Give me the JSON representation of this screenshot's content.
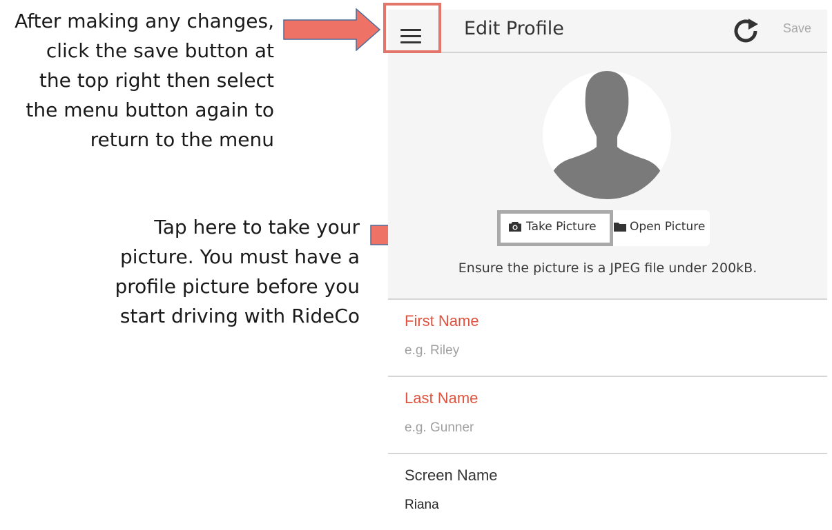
{
  "annotations": {
    "menu_note": [
      "After making any changes,",
      "click the save button at",
      "the top right then select",
      "the menu button again to",
      "return to the menu"
    ],
    "picture_note": [
      "Tap here to take your",
      "picture. You must have a",
      "profile picture before you",
      "start driving with RideCo"
    ],
    "arrow_color": "#ef7267",
    "highlight_menu_color": "#e4756a",
    "highlight_take_color": "#a9a9a9"
  },
  "header": {
    "menu_icon": "hamburger-menu-icon",
    "title": "Edit Profile",
    "refresh_icon": "refresh-icon",
    "save_label": "Save"
  },
  "photo": {
    "avatar_icon": "default-avatar-silhouette",
    "take_icon": "camera-icon",
    "take_label": "Take Picture",
    "open_icon": "folder-icon",
    "open_label": "Open Picture",
    "hint": "Ensure the picture is a JPEG file under 200kB."
  },
  "fields": {
    "first_name": {
      "label": "First Name",
      "placeholder": "e.g. Riley",
      "value": ""
    },
    "last_name": {
      "label": "Last Name",
      "placeholder": "e.g. Gunner",
      "value": ""
    },
    "screen_name": {
      "label": "Screen Name",
      "placeholder": "",
      "value": "Riana"
    }
  },
  "colors": {
    "required_label": "#e0533f",
    "header_bg": "#f5f5f5",
    "save_disabled": "#a8a8a8"
  }
}
